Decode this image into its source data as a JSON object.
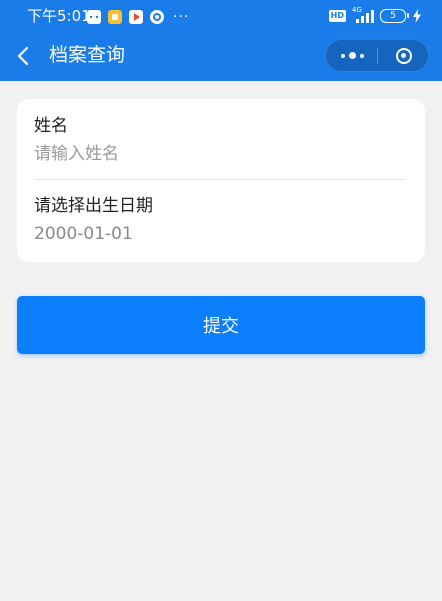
{
  "status_bar": {
    "time": "下午5:01",
    "more": "···",
    "hd": "HD",
    "network": "4G",
    "battery": "5"
  },
  "nav": {
    "title": "档案查询"
  },
  "form": {
    "name_label": "姓名",
    "name_placeholder": "请输入姓名",
    "name_value": "",
    "birth_label": "请选择出生日期",
    "birth_value": "2000-01-01"
  },
  "submit_label": "提交",
  "colors": {
    "primary": "#1a7ce8",
    "button": "#0a7efb",
    "background": "#f1f1f1"
  }
}
